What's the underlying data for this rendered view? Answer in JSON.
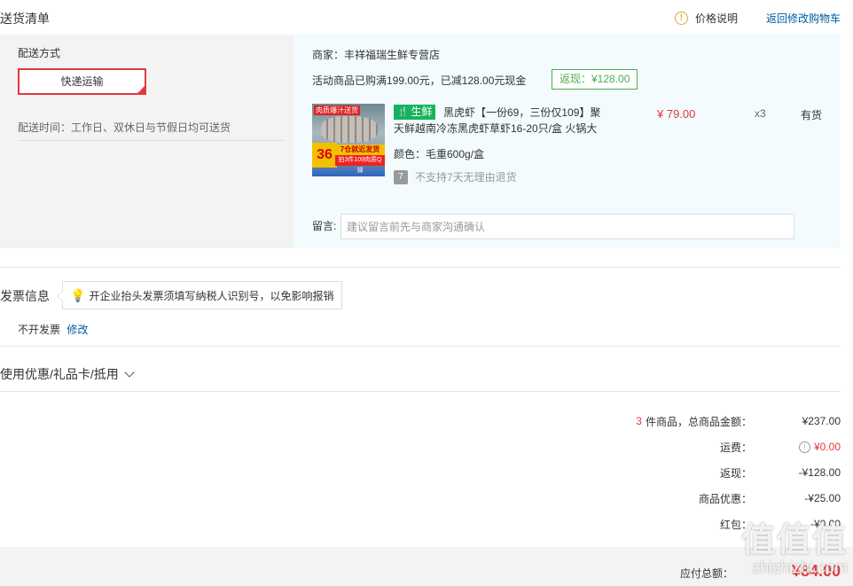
{
  "header": {
    "title": "送货清单",
    "price_note": "价格说明",
    "back_to_cart": "返回修改购物车"
  },
  "shipping": {
    "label": "配送方式",
    "method": "快递运输",
    "time": "配送时间：工作日、双休日与节假日均可送货"
  },
  "merchant": {
    "name": "商家：丰祥福瑞生鲜专营店",
    "promo": "活动商品已购满199.00元，已减128.00元现金",
    "rebate_badge": "返现：¥128.00"
  },
  "product": {
    "image_tag": "肉质爆汁送货",
    "image_strip1": "7仓就近发货",
    "image_strip2": "拍3件109肉质Q弹",
    "image_big": "36",
    "fresh_tag": "生鲜",
    "name": "黑虎虾【一份69，三份仅109】聚天鲜越南冷冻黑虎虾草虾16-20只/盒 火锅大",
    "price": "¥ 79.00",
    "qty": "x3",
    "stock": "有货",
    "color": "颜色：毛重600g/盒",
    "return_policy": "不支持7天无理由退货"
  },
  "message": {
    "label": "留言:",
    "placeholder": "建议留言前先与商家沟通确认"
  },
  "invoice": {
    "title": "发票信息",
    "tip": "开企业抬头发票须填写纳税人识别号，以免影响报销",
    "status": "不开发票",
    "edit": "修改"
  },
  "coupon": {
    "label": "使用优惠/礼品卡/抵用"
  },
  "summary": {
    "count": "3",
    "total_label": "件商品，总商品金额：",
    "total": "¥237.00",
    "shipping_label": "运费：",
    "shipping": "¥0.00",
    "rebate_label": "返现：",
    "rebate": "-¥128.00",
    "discount_label": "商品优惠：",
    "discount": "-¥25.00",
    "redpacket_label": "红包：",
    "redpacket": "-¥0.00",
    "payable_label": "应付总额：",
    "payable": "¥84.00"
  },
  "watermark": {
    "text": "值值值",
    "site": "zhizhizhi.com"
  },
  "colors": {
    "accent_red": "#e4393c",
    "link_blue": "#005aa0",
    "fresh_green": "#17b35e",
    "rebate_green": "#4caf50"
  }
}
